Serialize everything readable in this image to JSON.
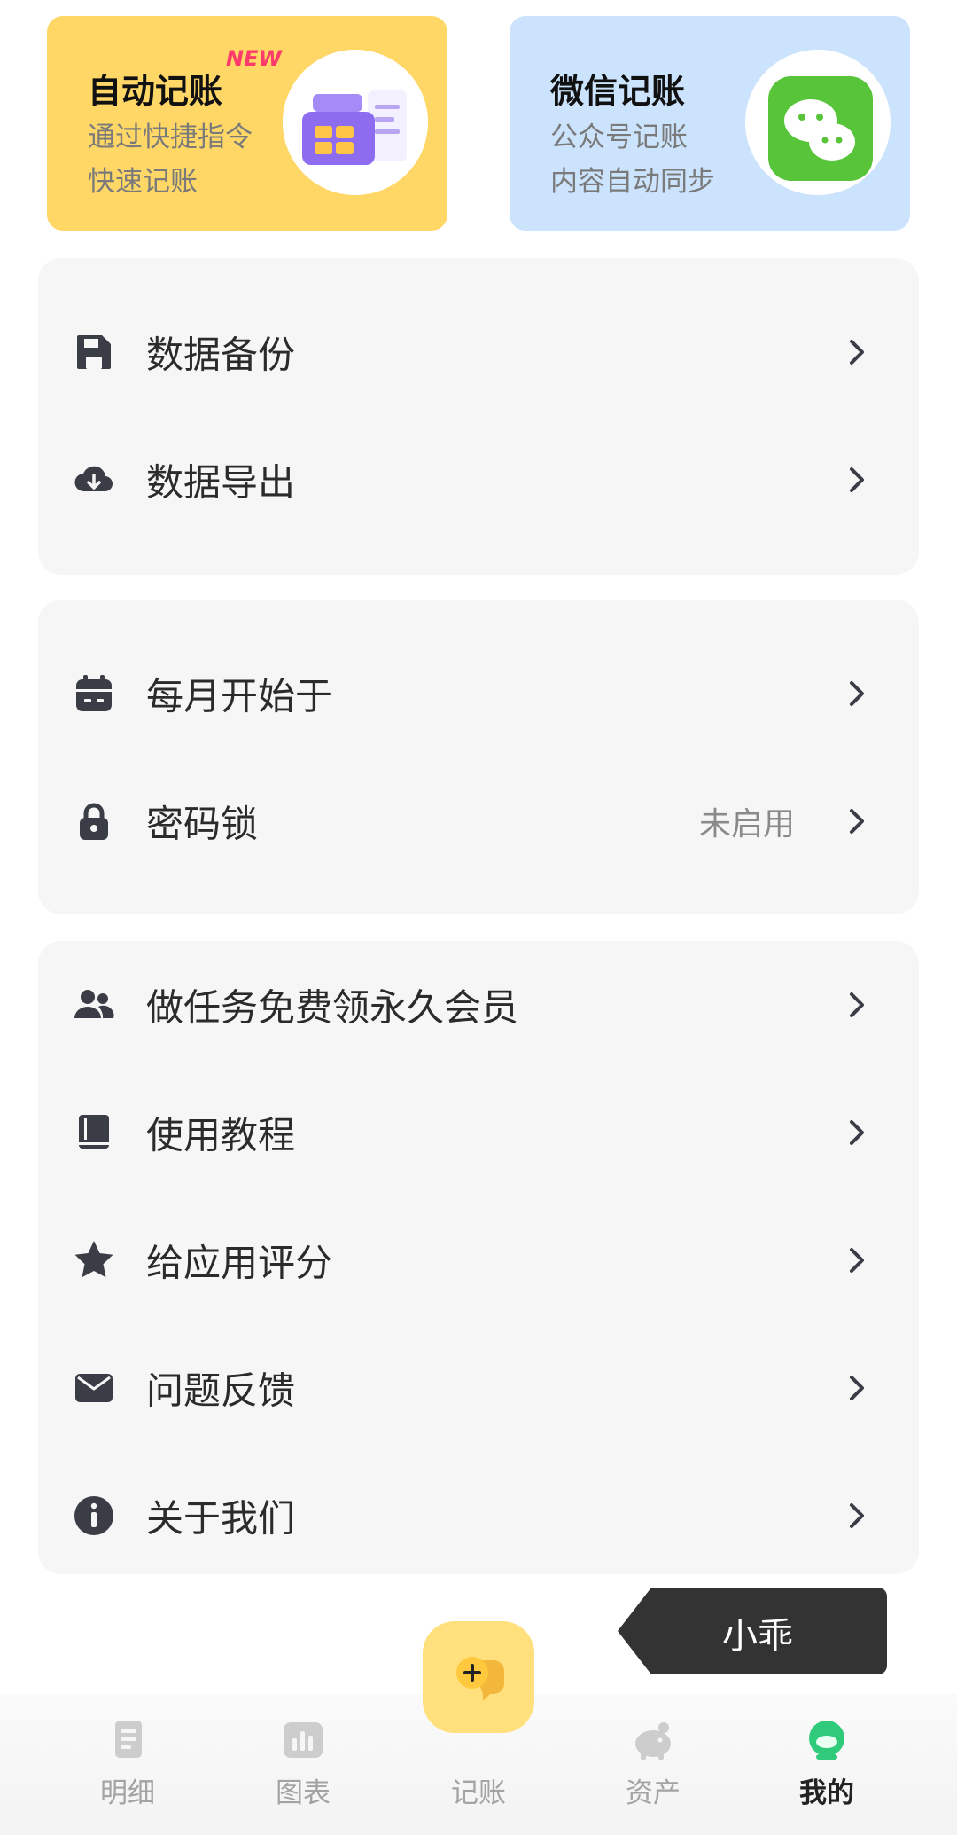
{
  "promos": {
    "auto": {
      "title": "自动记账",
      "badge": "NEW",
      "line1": "通过快捷指令",
      "line2": "快速记账"
    },
    "wechat": {
      "title": "微信记账",
      "line1": "公众号记账",
      "line2": "内容自动同步"
    }
  },
  "groups": {
    "data": [
      {
        "label": "数据备份",
        "icon": "save-icon"
      },
      {
        "label": "数据导出",
        "icon": "cloud-download-icon"
      }
    ],
    "settings": [
      {
        "label": "每月开始于",
        "icon": "calendar-icon"
      },
      {
        "label": "密码锁",
        "icon": "lock-icon",
        "value": "未启用"
      }
    ],
    "more": [
      {
        "label": "做任务免费领永久会员",
        "icon": "users-icon"
      },
      {
        "label": "使用教程",
        "icon": "book-icon"
      },
      {
        "label": "给应用评分",
        "icon": "star-icon"
      },
      {
        "label": "问题反馈",
        "icon": "mail-icon"
      },
      {
        "label": "关于我们",
        "icon": "info-icon"
      }
    ]
  },
  "tooltip": {
    "text": "小乖"
  },
  "nav": {
    "items": [
      {
        "label": "明细",
        "icon": "receipt-icon"
      },
      {
        "label": "图表",
        "icon": "chart-icon"
      },
      {
        "label": "记账",
        "icon": "add-chat-icon"
      },
      {
        "label": "资产",
        "icon": "piggy-bank-icon"
      },
      {
        "label": "我的",
        "icon": "profile-icon"
      }
    ],
    "active": "我的"
  },
  "colors": {
    "auto_card": "#FFD766",
    "wechat_card": "#CBE3FC",
    "group_bg": "#F6F6F6",
    "fab": "#FFE07D",
    "badge": "#FF3B6B",
    "active_green": "#2FCB7A"
  }
}
